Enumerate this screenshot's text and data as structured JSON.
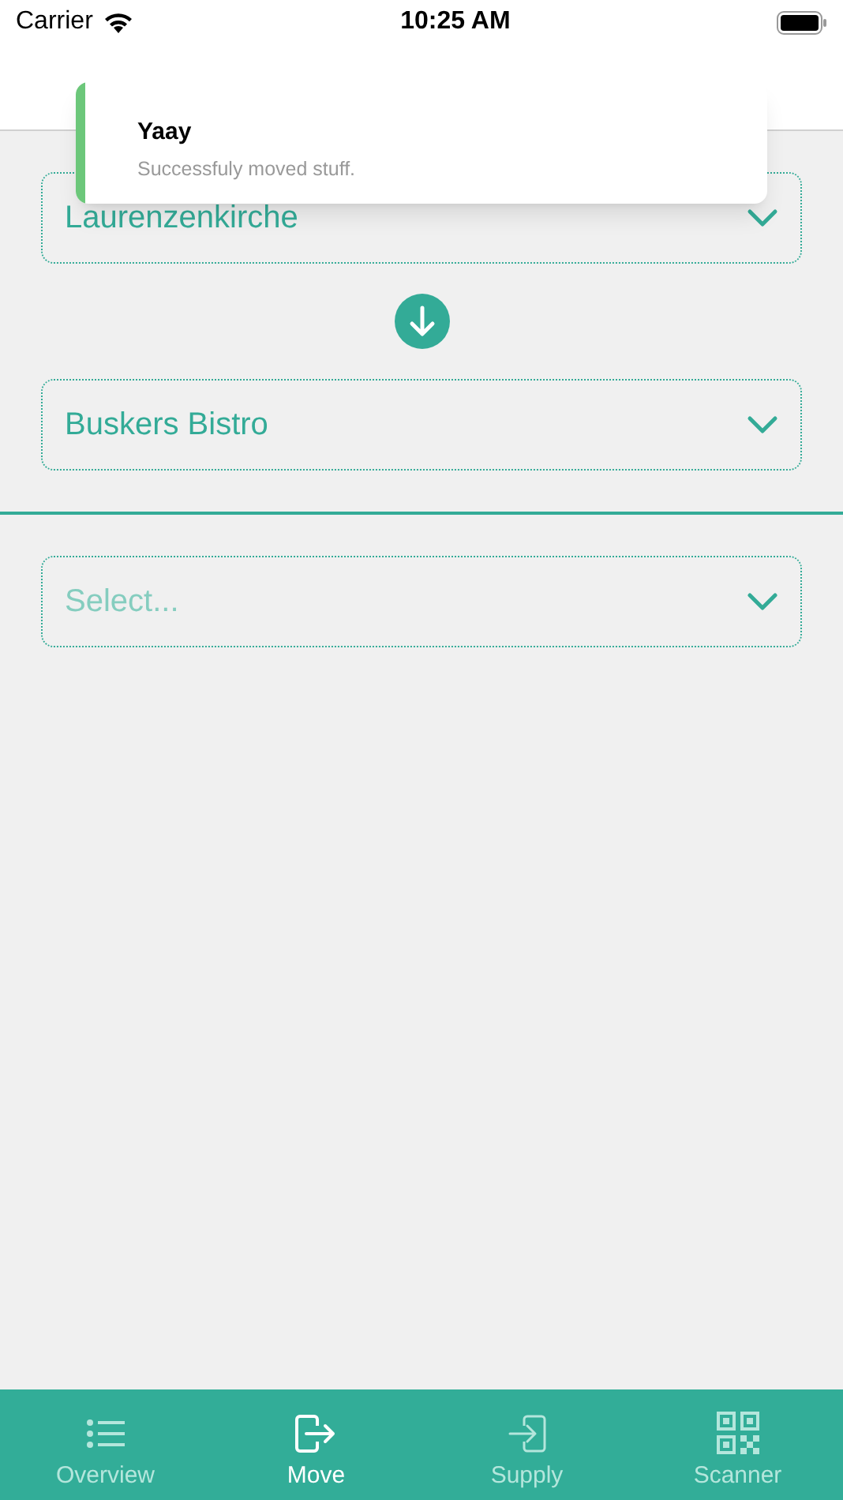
{
  "status_bar": {
    "carrier": "Carrier",
    "time": "10:25 AM"
  },
  "toast": {
    "title": "Yaay",
    "message": "Successfuly moved stuff."
  },
  "from_select": {
    "value": "Laurenzenkirche"
  },
  "to_select": {
    "value": "Buskers Bistro"
  },
  "item_select": {
    "placeholder": "Select..."
  },
  "tabs": [
    {
      "label": "Overview",
      "kind": "list",
      "selected": false
    },
    {
      "label": "Move",
      "kind": "move",
      "selected": true
    },
    {
      "label": "Supply",
      "kind": "supply",
      "selected": false
    },
    {
      "label": "Scanner",
      "kind": "qr",
      "selected": false
    }
  ]
}
